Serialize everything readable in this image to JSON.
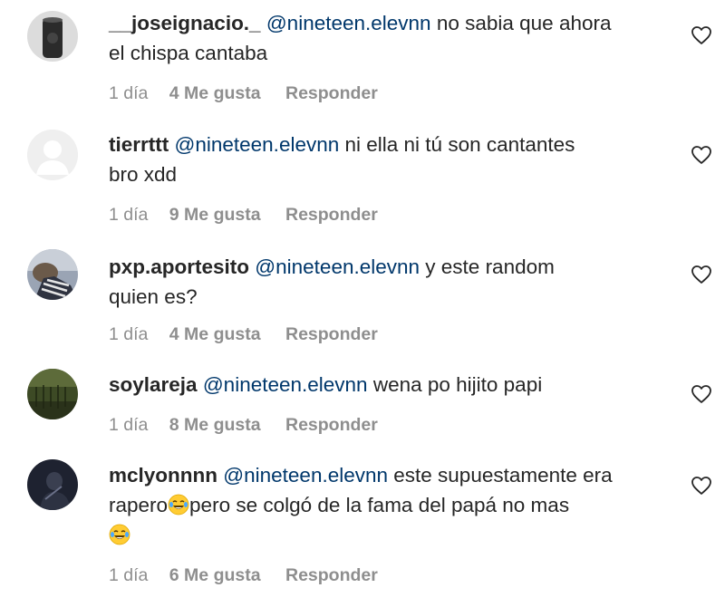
{
  "comments": [
    {
      "username": "__joseignacio._",
      "mention": "@nineteen.elevnn",
      "text_1": " no sabia que ahora",
      "text_2": "el chispa cantaba",
      "time": "1 día",
      "likes": "4 Me gusta",
      "reply": "Responder",
      "avatar_icon": "dark-can-avatar"
    },
    {
      "username": "tierrttt",
      "mention": "@nineteen.elevnn",
      "text_1": " ni ella ni tú son cantantes",
      "text_2": "bro xdd",
      "time": "1 día",
      "likes": "9 Me gusta",
      "reply": "Responder",
      "avatar_icon": "default-user-avatar"
    },
    {
      "username": "pxp.aportesito",
      "mention": "@nineteen.elevnn",
      "text_1": " y este random",
      "text_2": "quien es?",
      "time": "1 día",
      "likes": "4 Me gusta",
      "reply": "Responder",
      "avatar_icon": "photo-avatar"
    },
    {
      "username": "soylareja",
      "mention": "@nineteen.elevnn",
      "text_1": " wena po hijito papi",
      "time": "1 día",
      "likes": "8 Me gusta",
      "reply": "Responder",
      "avatar_icon": "green-photo-avatar"
    },
    {
      "username": "mclyonnnn",
      "mention": "@nineteen.elevnn",
      "text_1": " este supuestamente era",
      "text_2a": "rapero",
      "text_2b": "pero se colgó de la fama del papá no mas",
      "time": "1 día",
      "likes": "6 Me gusta",
      "reply": "Responder",
      "avatar_icon": "dark-photo-avatar",
      "emoji": "laughing-tears-emoji"
    }
  ],
  "icons": {
    "like": "heart-outline-icon"
  },
  "colors": {
    "mention": "#00376b",
    "meta": "#8e8e8e",
    "text": "#262626"
  }
}
